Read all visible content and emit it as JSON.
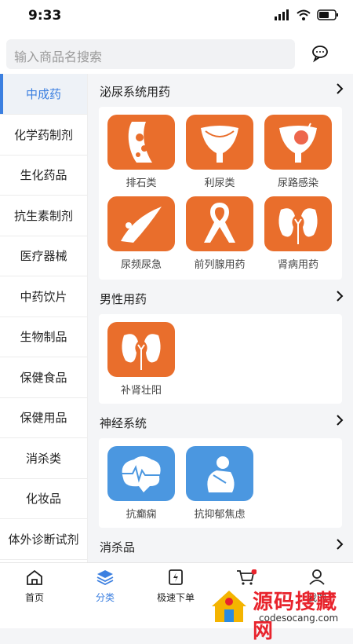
{
  "status": {
    "time": "9:33"
  },
  "search": {
    "placeholder": "输入商品名搜索"
  },
  "sidebar": {
    "items": [
      "中成药",
      "化学药制剂",
      "生化药品",
      "抗生素制剂",
      "医疗器械",
      "中药饮片",
      "生物制品",
      "保健食品",
      "保健用品",
      "消杀类",
      "化妆品",
      "体外诊断试剂"
    ]
  },
  "sections": [
    {
      "title": "泌尿系统用药",
      "items": [
        "排石类",
        "利尿类",
        "尿路感染",
        "尿频尿急",
        "前列腺用药",
        "肾病用药"
      ]
    },
    {
      "title": "男性用药",
      "items": [
        "补肾壮阳"
      ]
    },
    {
      "title": "神经系统",
      "items": [
        "抗癫痫",
        "抗抑郁焦虑"
      ]
    },
    {
      "title": "消杀品",
      "items": []
    }
  ],
  "tabs": [
    "首页",
    "分类",
    "极速下单",
    "",
    "我的"
  ],
  "watermark": {
    "cn": "源码搜藏网",
    "en": "codesocang.com"
  },
  "colors": {
    "accent": "#3b7fe0",
    "orange_icon": "#e96e2c",
    "blue_icon": "#4b97e0"
  }
}
